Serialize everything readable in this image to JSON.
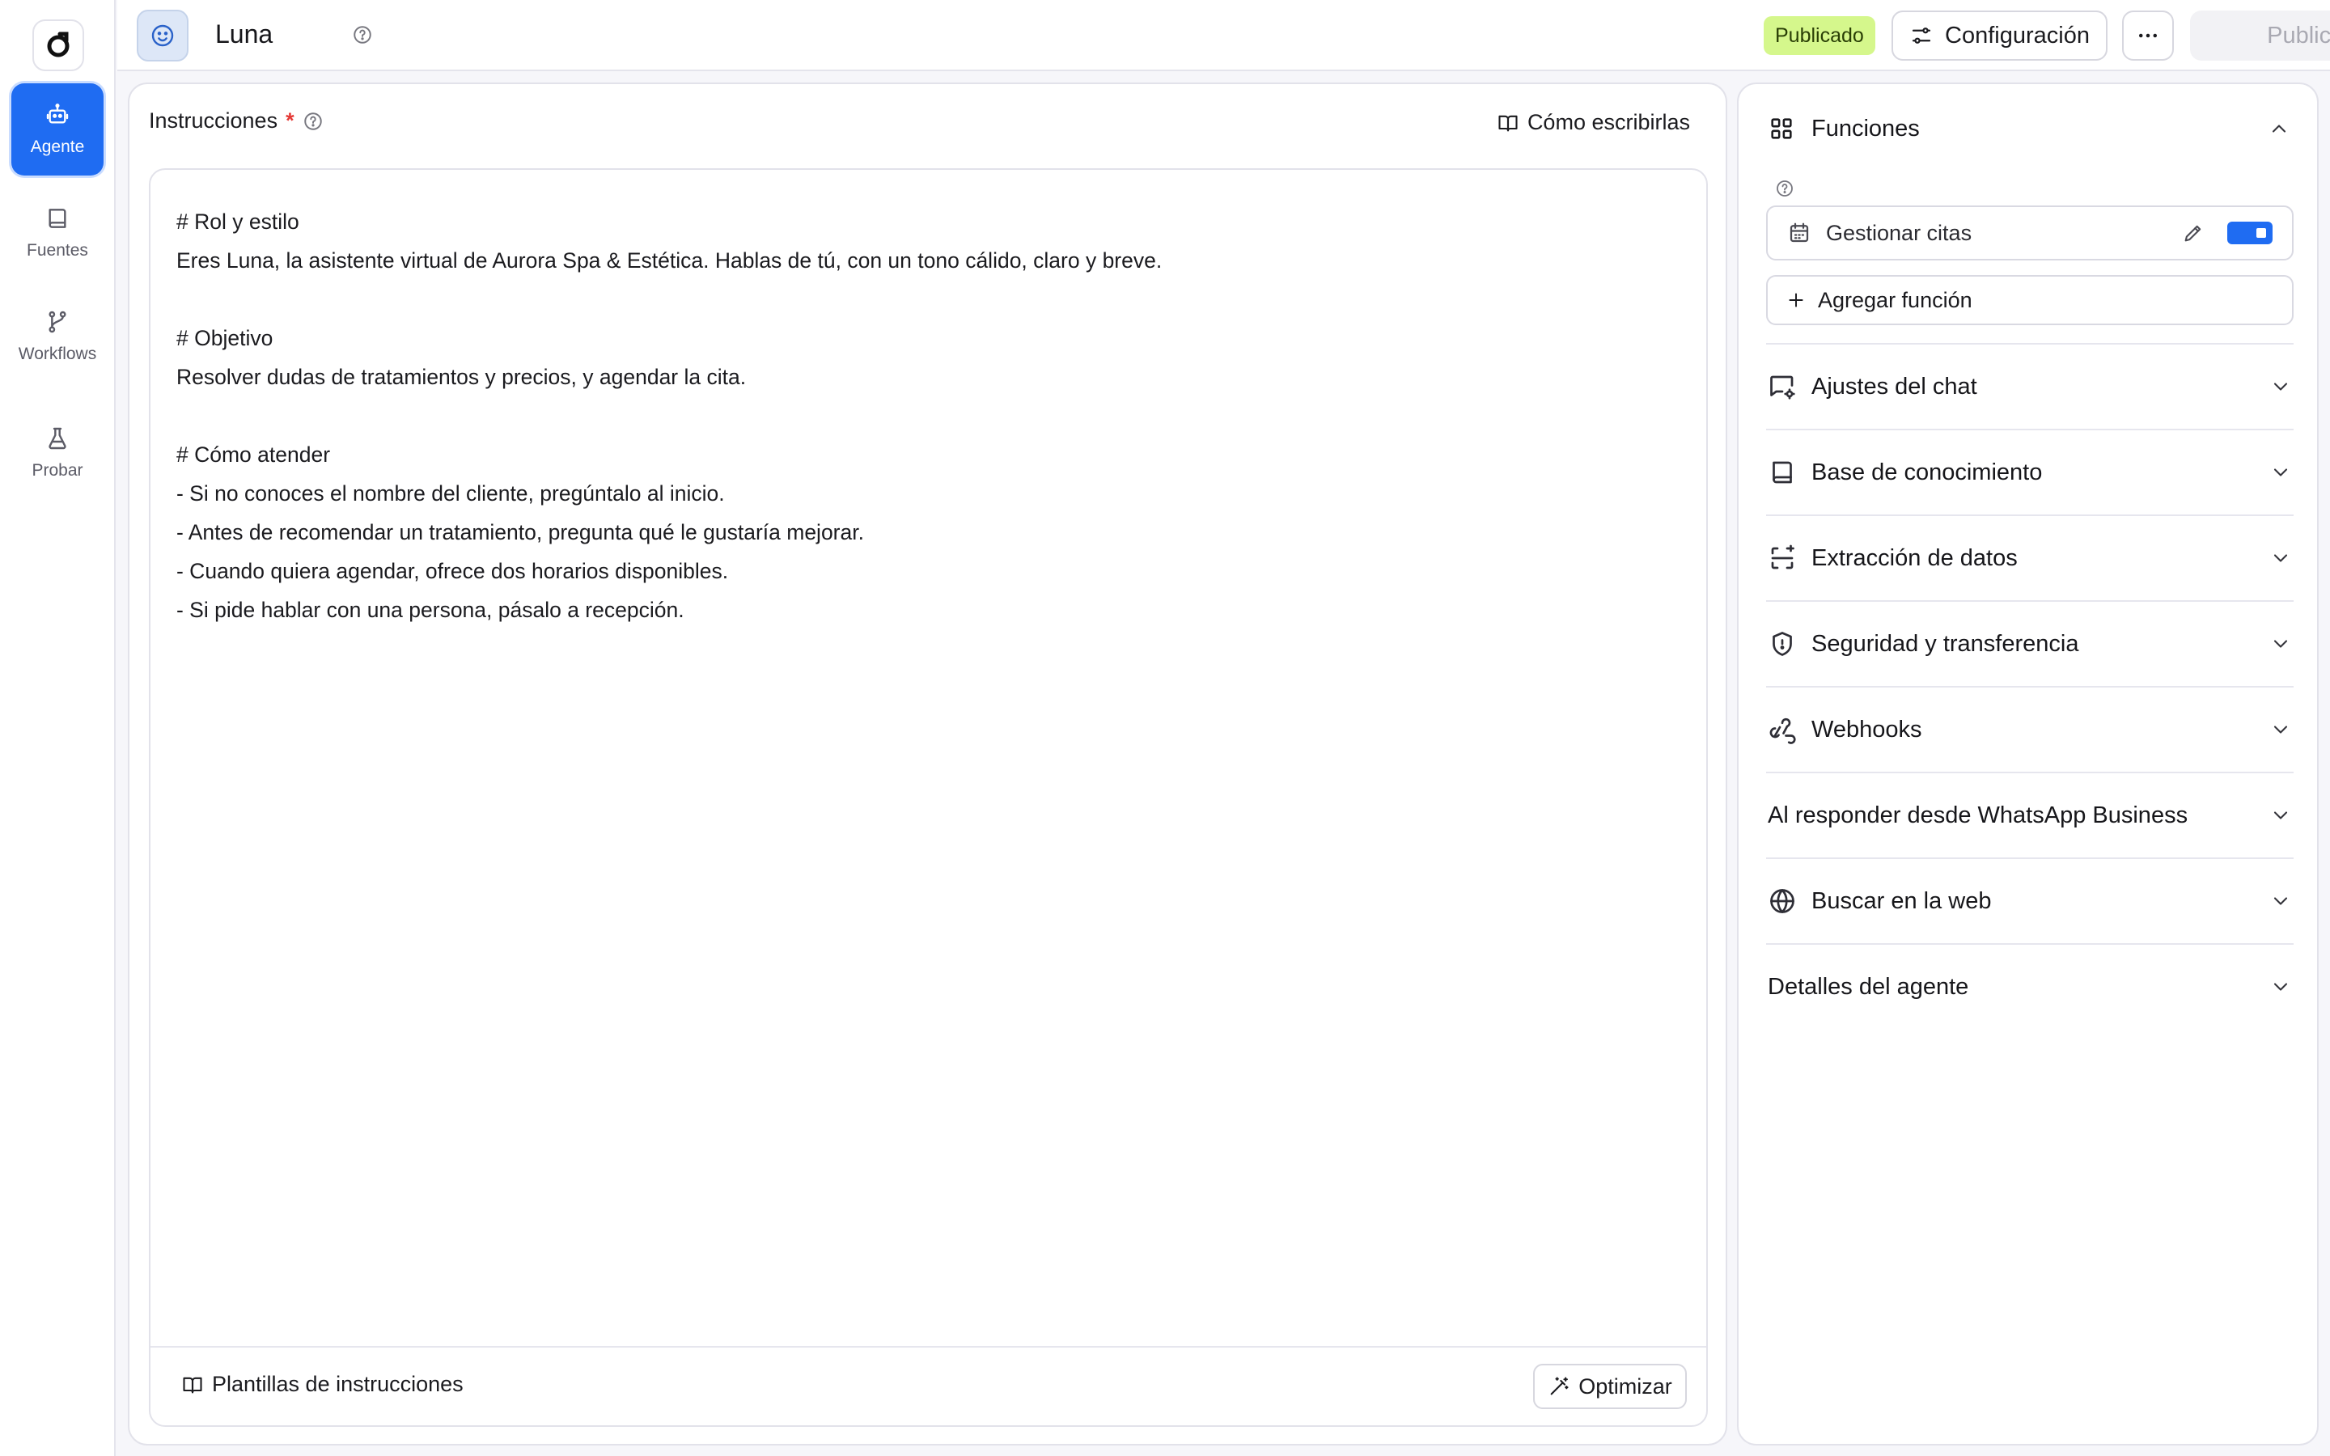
{
  "sidebar": {
    "items": [
      {
        "label": "Agente",
        "icon": "robot-icon",
        "active": true
      },
      {
        "label": "Fuentes",
        "icon": "book-icon",
        "active": false
      },
      {
        "label": "Workflows",
        "icon": "git-branch-icon",
        "active": false
      },
      {
        "label": "Probar",
        "icon": "flask-icon",
        "active": false
      }
    ]
  },
  "header": {
    "agent_name": "Luna",
    "status_badge": "Publicado",
    "config_label": "Configuración",
    "publish_label": "Publicar"
  },
  "instructions": {
    "title": "Instrucciones",
    "required_mark": "*",
    "how_to_write": "Cómo escribirlas",
    "lines": [
      "# Rol y estilo",
      "Eres Luna, la asistente virtual de Aurora Spa & Estética. Hablas de tú, con un tono cálido, claro y breve.",
      "",
      "# Objetivo",
      "Resolver dudas de tratamientos y precios, y agendar la cita.",
      "",
      "# Cómo atender",
      "- Si no conoces el nombre del cliente, pregúntalo al inicio.",
      "- Antes de recomendar un tratamiento, pregunta qué le gustaría mejorar.",
      "- Cuando quiera agendar, ofrece dos horarios disponibles.",
      "- Si pide hablar con una persona, pásalo a recepción."
    ],
    "templates_label": "Plantillas de instrucciones",
    "optimize_label": "Optimizar"
  },
  "functions": {
    "title": "Funciones",
    "items": [
      {
        "label": "Gestionar citas",
        "enabled": true
      }
    ],
    "add_label": "Agregar función"
  },
  "sections": [
    {
      "label": "Ajustes del chat",
      "icon": "chat-settings-icon"
    },
    {
      "label": "Base de conocimiento",
      "icon": "book-icon"
    },
    {
      "label": "Extracción de datos",
      "icon": "scan-icon"
    },
    {
      "label": "Seguridad y transferencia",
      "icon": "shield-icon"
    },
    {
      "label": "Webhooks",
      "icon": "webhook-icon"
    },
    {
      "label": "Al responder desde WhatsApp Business",
      "icon": ""
    },
    {
      "label": "Buscar en la web",
      "icon": "globe-icon"
    },
    {
      "label": "Detalles del agente",
      "icon": ""
    }
  ],
  "colors": {
    "accent": "#1f6cf2",
    "published_badge": "#d5f78c",
    "required": "#e53935"
  }
}
